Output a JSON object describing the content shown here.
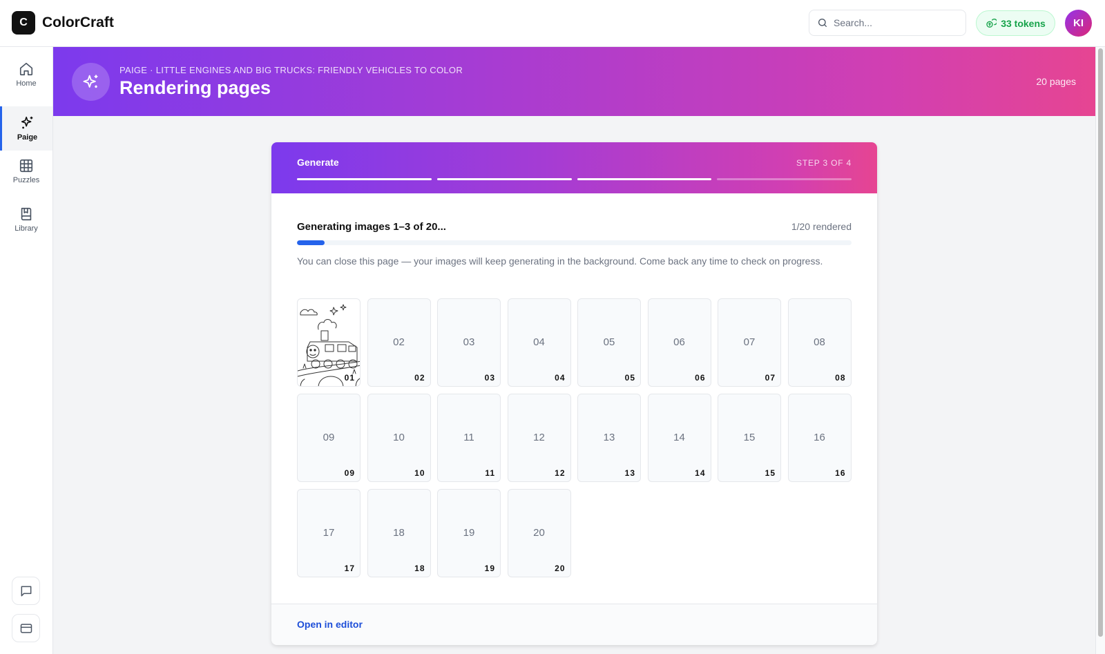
{
  "app": {
    "logo_letter": "C",
    "name": "ColorCraft"
  },
  "search": {
    "placeholder": "Search..."
  },
  "tokens": {
    "label": "33 tokens"
  },
  "user": {
    "initials": "KI"
  },
  "sidebar": {
    "items": [
      {
        "label": "Home",
        "icon": "home-icon"
      },
      {
        "label": "Paige",
        "icon": "sparkles-icon"
      },
      {
        "label": "Puzzles",
        "icon": "grid-icon"
      },
      {
        "label": "Library",
        "icon": "book-icon"
      }
    ],
    "bottom_buttons": [
      {
        "icon": "chat-icon"
      },
      {
        "icon": "card-icon"
      }
    ]
  },
  "header": {
    "breadcrumb": "PAIGE · LITTLE ENGINES AND BIG TRUCKS: FRIENDLY VEHICLES TO COLOR",
    "title": "Rendering pages",
    "page_count": "20 pages"
  },
  "wizard": {
    "step_label": "Generate",
    "step_count": "STEP 3 OF 4",
    "current_step": 3,
    "total_steps": 4,
    "status": "Generating images 1–3 of 20...",
    "rendered": "1/20 rendered",
    "progress_fraction": 0.05,
    "note": "You can close this page — your images will keep generating in the background. Come back any time to check on progress.",
    "pages": [
      {
        "label": "01",
        "rendered": true
      },
      {
        "label": "02",
        "rendered": false
      },
      {
        "label": "03",
        "rendered": false
      },
      {
        "label": "04",
        "rendered": false
      },
      {
        "label": "05",
        "rendered": false
      },
      {
        "label": "06",
        "rendered": false
      },
      {
        "label": "07",
        "rendered": false
      },
      {
        "label": "08",
        "rendered": false
      },
      {
        "label": "09",
        "rendered": false
      },
      {
        "label": "10",
        "rendered": false
      },
      {
        "label": "11",
        "rendered": false
      },
      {
        "label": "12",
        "rendered": false
      },
      {
        "label": "13",
        "rendered": false
      },
      {
        "label": "14",
        "rendered": false
      },
      {
        "label": "15",
        "rendered": false
      },
      {
        "label": "16",
        "rendered": false
      },
      {
        "label": "17",
        "rendered": false
      },
      {
        "label": "18",
        "rendered": false
      },
      {
        "label": "19",
        "rendered": false
      },
      {
        "label": "20",
        "rendered": false
      }
    ],
    "open_editor": "Open in editor"
  },
  "colors": {
    "accent": "#2563eb",
    "gradient_start": "#7c3aed",
    "gradient_end": "#e64592",
    "tokens_green": "#16a34a"
  }
}
